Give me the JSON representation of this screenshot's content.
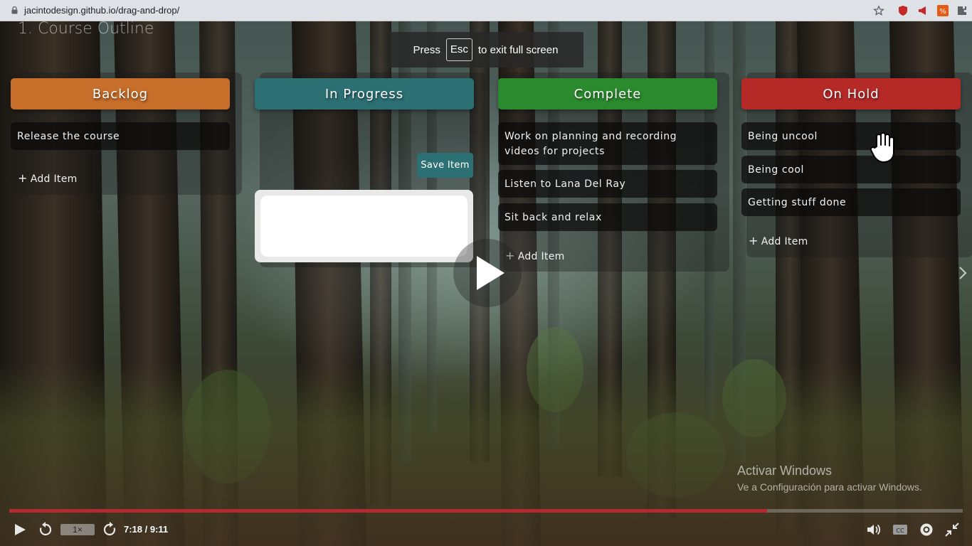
{
  "browser": {
    "url": "jacintodesign.github.io/drag-and-drop/"
  },
  "video": {
    "title": "1. Course Outline",
    "fullscreen_toast": {
      "prefix": "Press",
      "key": "Esc",
      "suffix": "to exit full screen"
    },
    "progress_fraction": 0.795,
    "speed_label": "1×",
    "time": "7:18 / 9:11",
    "accent_color": "#b32a30"
  },
  "board": {
    "columns": [
      {
        "name": "Backlog",
        "color": "#c76e2b",
        "items": [
          "Release the course"
        ],
        "add_label": "Add Item"
      },
      {
        "name": "In Progress",
        "color": "#2c7074",
        "items": [],
        "save_label": "Save Item"
      },
      {
        "name": "Complete",
        "color": "#2b8a2e",
        "items": [
          "Work on planning and recording videos for projects",
          "Listen to Lana Del Ray",
          "Sit back and relax"
        ],
        "add_label": "Add Item"
      },
      {
        "name": "On Hold",
        "color": "#b52a27",
        "items": [
          "Being uncool",
          "Being cool",
          "Getting stuff done"
        ],
        "add_label": "Add Item"
      }
    ]
  },
  "watermark": {
    "line1": "Activar Windows",
    "line2": "Ve a Configuración para activar Windows."
  },
  "icons": [
    "lock-icon",
    "star-icon",
    "extension-icon",
    "play-icon",
    "replay-icon",
    "forward-icon",
    "volume-icon",
    "captions-icon",
    "settings-icon",
    "exit-fullscreen-icon",
    "next-arrow-icon",
    "hand-cursor-icon"
  ]
}
